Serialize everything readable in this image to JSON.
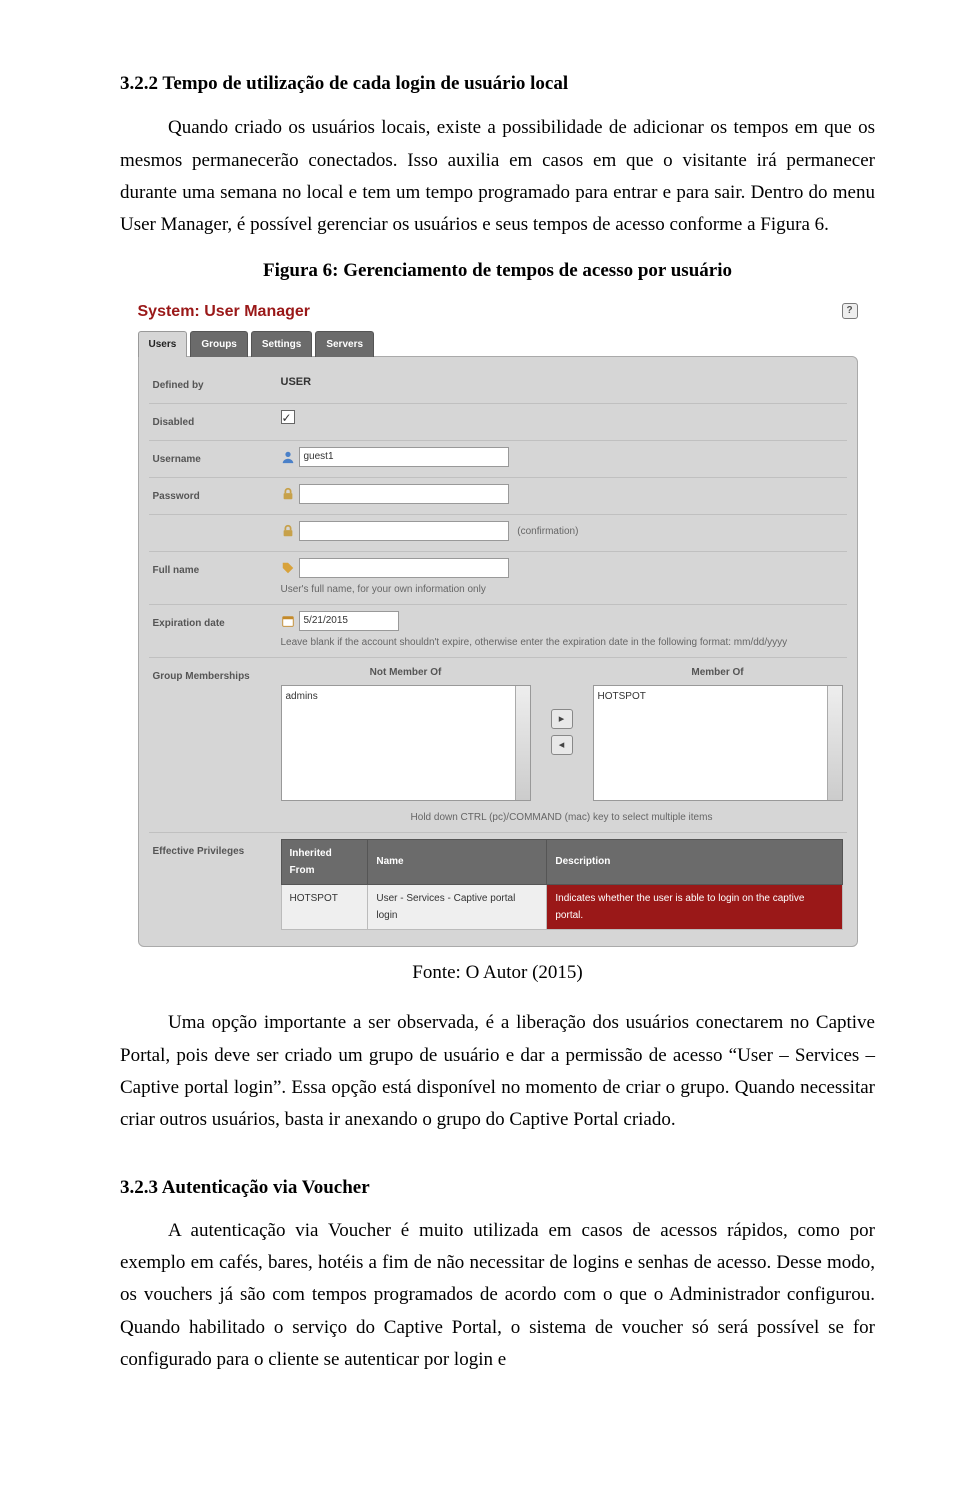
{
  "doc": {
    "h1": "3.2.2   Tempo de utilização de cada login de usuário local",
    "p1": "Quando criado os usuários locais, existe a possibilidade de adicionar os tempos em que os mesmos permanecerão conectados. Isso auxilia em casos em que o visitante irá permanecer durante uma semana no local e tem um tempo programado para entrar e para sair. Dentro do menu User Manager, é possível gerenciar os usuários e seus tempos de acesso conforme a Figura 6.",
    "fig_caption": "Figura 6: Gerenciamento de tempos de acesso por usuário",
    "fig_source": "Fonte: O Autor (2015)",
    "p2": "Uma opção importante a ser observada, é a liberação dos usuários conectarem no Captive Portal, pois deve ser criado um grupo de usuário e dar a permissão de acesso “User – Services – Captive portal login”. Essa opção está disponível no momento de criar o grupo. Quando necessitar criar outros usuários, basta ir anexando o grupo do Captive Portal criado.",
    "h2": "3.2.3   Autenticação via Voucher",
    "p3": "A autenticação via Voucher é muito utilizada em casos de acessos rápidos, como por exemplo em cafés, bares, hotéis a fim de não necessitar de logins e senhas de acesso. Desse modo, os vouchers já são com tempos programados de acordo com o que o Administrador configurou. Quando habilitado o serviço do Captive Portal, o sistema de voucher só será possível se for configurado para o cliente se autenticar por login e"
  },
  "shot": {
    "title": "System: User Manager",
    "help_char": "?",
    "tabs": [
      "Users",
      "Groups",
      "Settings",
      "Servers"
    ],
    "rows": {
      "defined_label": "Defined by",
      "defined_value": "USER",
      "disabled_label": "Disabled",
      "username_label": "Username",
      "username_value": "guest1",
      "password_label": "Password",
      "confirm_hint": "(confirmation)",
      "fullname_label": "Full name",
      "fullname_hint": "User's full name, for your own information only",
      "expire_label": "Expiration date",
      "expire_value": "5/21/2015",
      "expire_hint": "Leave blank if the account shouldn't expire, otherwise enter the expiration date in the following format: mm/dd/yyyy",
      "groups_label": "Group Memberships",
      "not_member": "Not Member Of",
      "member_of": "Member Of",
      "left_item": "admins",
      "right_item": "HOTSPOT",
      "hold_note": "Hold down CTRL (pc)/COMMAND (mac) key to select multiple items",
      "eff_label": "Effective Privileges",
      "th1": "Inherited From",
      "th2": "Name",
      "th3": "Description",
      "td1": "HOTSPOT",
      "td2": "User - Services - Captive portal login",
      "td3": "Indicates whether the user is able to login on the captive portal."
    }
  }
}
